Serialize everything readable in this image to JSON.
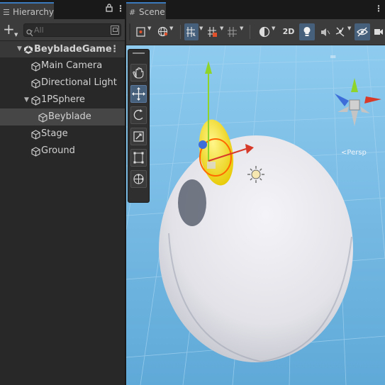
{
  "hierarchy": {
    "tab_label": "Hierarchy",
    "search_placeholder": "All",
    "scene_name": "BeybladeGame",
    "items": [
      {
        "label": "Main Camera"
      },
      {
        "label": "Directional Light"
      },
      {
        "label": "1PSphere"
      },
      {
        "label": "Beyblade"
      },
      {
        "label": "Stage"
      },
      {
        "label": "Ground"
      }
    ]
  },
  "scene": {
    "tab_label": "Scene",
    "toolbar": {
      "mode_2d_label": "2D"
    },
    "view_label": "Persp"
  },
  "colors": {
    "selection_accent": "#3a79bb",
    "sky": "#7fbfe6",
    "bowl": "#e8e8ee",
    "beyblade": "#f2e32a",
    "outline": "#ff6a00"
  }
}
